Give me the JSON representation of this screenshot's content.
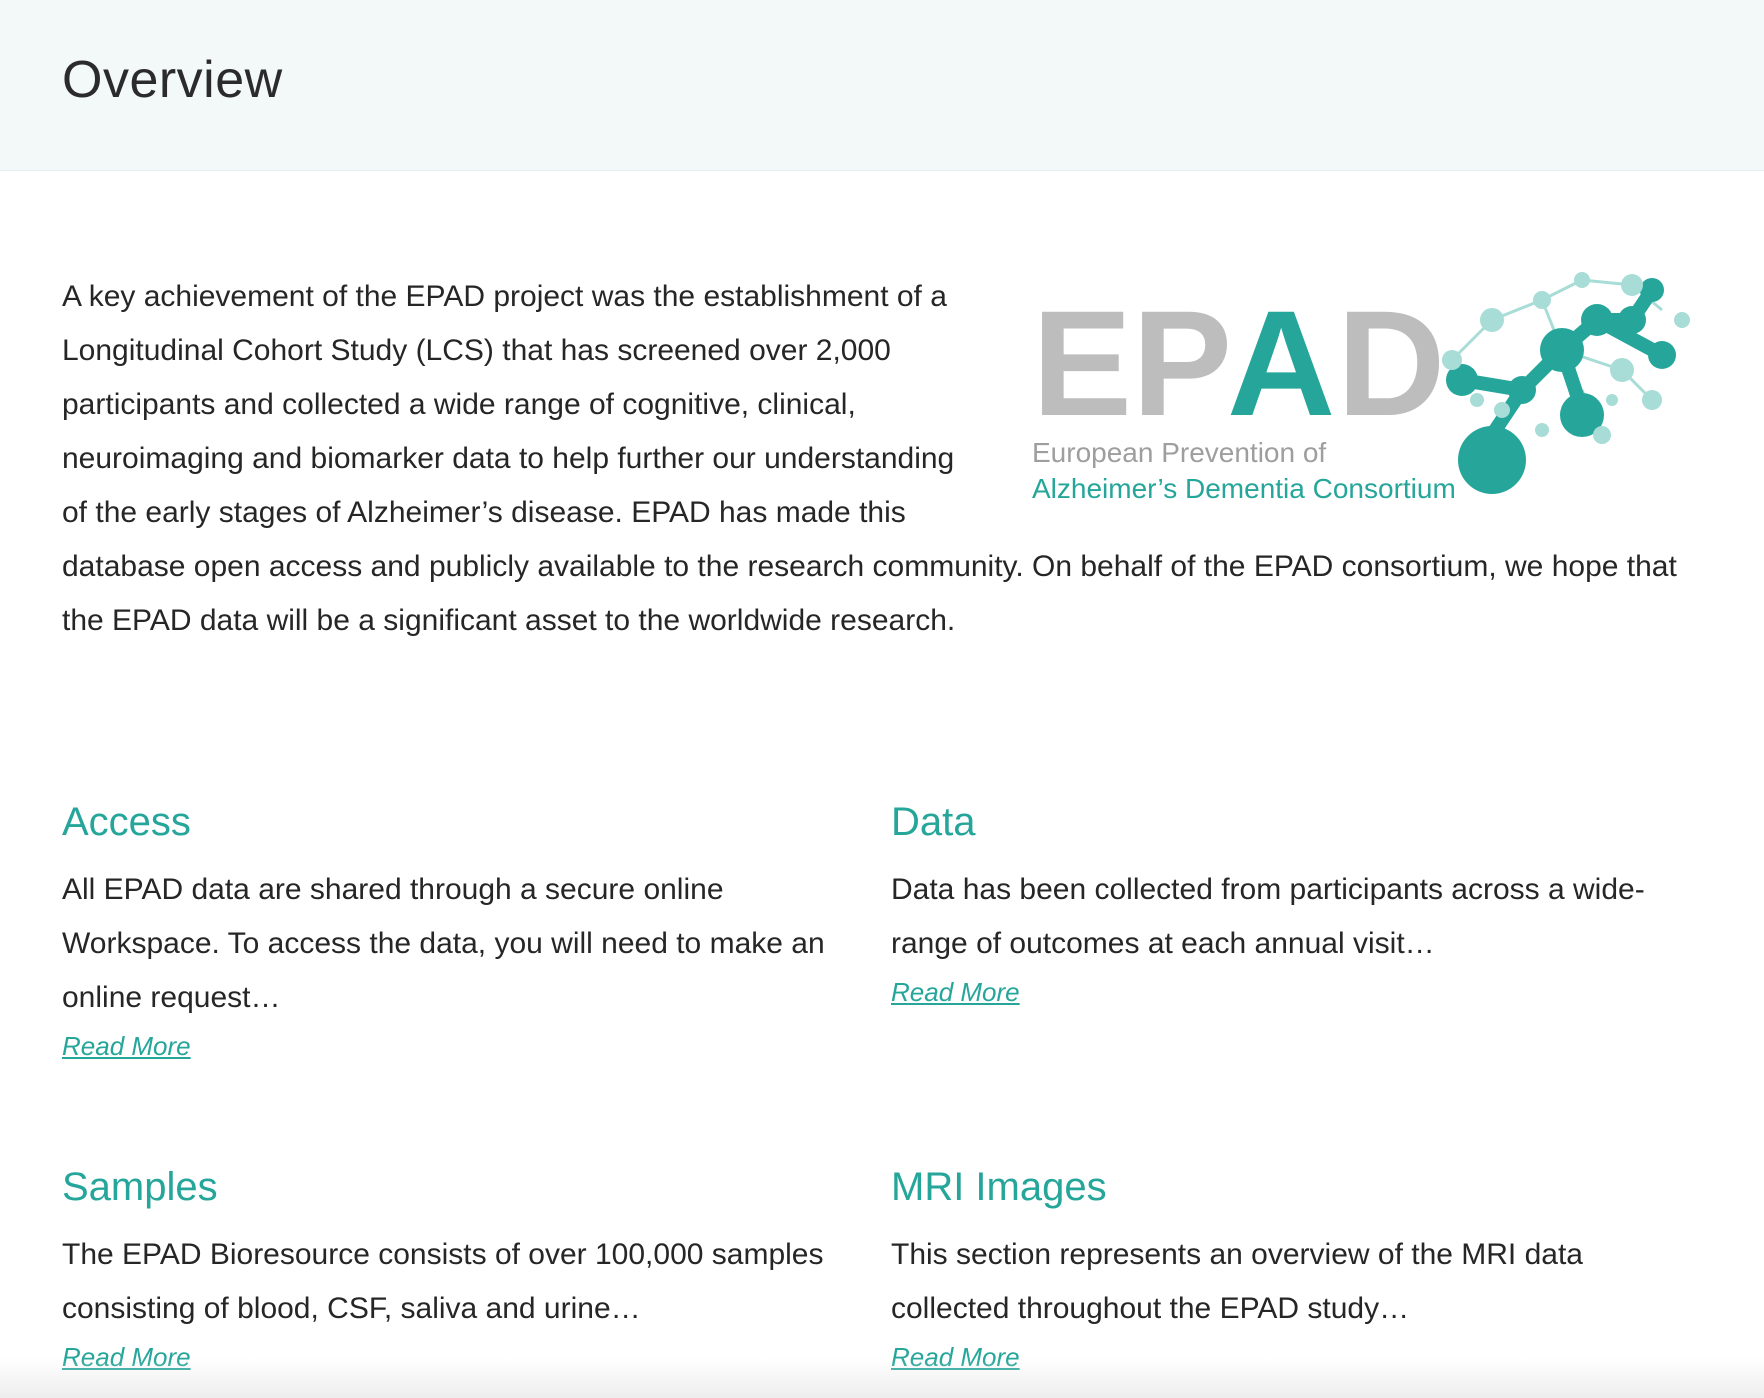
{
  "header": {
    "title": "Overview"
  },
  "intro": {
    "text": "A key achievement of the EPAD project was the establishment of a Longitudinal Cohort Study (LCS) that has screened over 2,000 participants and collected a wide range of cognitive, clinical, neuroimaging and biomarker data to help further our understanding of the early stages of Alzheimer’s disease. EPAD has made this database open access and publicly available to the research community. On behalf of the EPAD consortium, we hope that the EPAD data will be a significant asset to the worldwide research."
  },
  "logo": {
    "letters_gray": "EP",
    "letter_teal": "A",
    "letter_gray_end": "D",
    "line1": "European Prevention of",
    "line2": "Alzheimer’s Dementia Consortium",
    "colors": {
      "gray": "#bdbdbd",
      "teal": "#26a69a",
      "light_teal": "#a8dcd6"
    }
  },
  "cards": [
    {
      "title": "Access",
      "text": "All EPAD data are shared through a secure online Workspace. To access the data, you will need to make an online request…",
      "link": "Read More"
    },
    {
      "title": "Data",
      "text": "Data has been collected from participants across a wide-range of outcomes at each annual visit…",
      "link": "Read More"
    },
    {
      "title": "Samples",
      "text": "The EPAD Bioresource consists of over 100,000 samples consisting of blood, CSF, saliva and urine…",
      "link": "Read More"
    },
    {
      "title": "MRI Images",
      "text": "This section represents an overview of the MRI data collected throughout the EPAD study…",
      "link": "Read More"
    }
  ],
  "theme": {
    "accent": "#26a69a",
    "header_bg": "#f3f8f8"
  }
}
